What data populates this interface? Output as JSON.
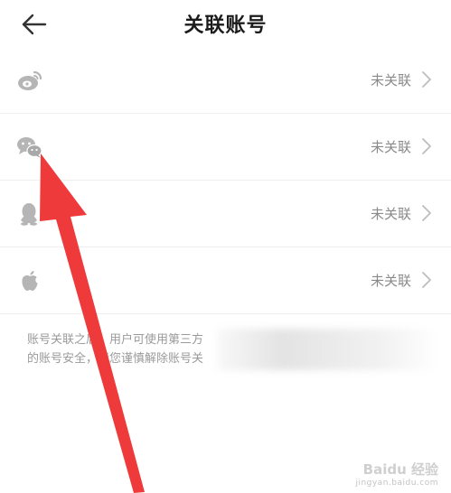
{
  "header": {
    "back_icon": "arrow-left-icon",
    "title": "关联账号"
  },
  "accounts": [
    {
      "platform": "weibo",
      "icon": "weibo-icon",
      "status": "未关联"
    },
    {
      "platform": "wechat",
      "icon": "wechat-icon",
      "status": "未关联"
    },
    {
      "platform": "qq",
      "icon": "qq-icon",
      "status": "未关联"
    },
    {
      "platform": "apple",
      "icon": "apple-icon",
      "status": "未关联"
    }
  ],
  "notice": {
    "line1": "账号关联之后，用户可使用第三方",
    "line2": "的账号安全，请您谨慎解除账号关"
  },
  "watermark": {
    "main": "Baidu 经验",
    "sub": "jingyan.baidu.com"
  },
  "colors": {
    "arrow": "#ee3a3a",
    "status_text": "#8a8a8a",
    "icon_gray": "#b5b5b5"
  }
}
